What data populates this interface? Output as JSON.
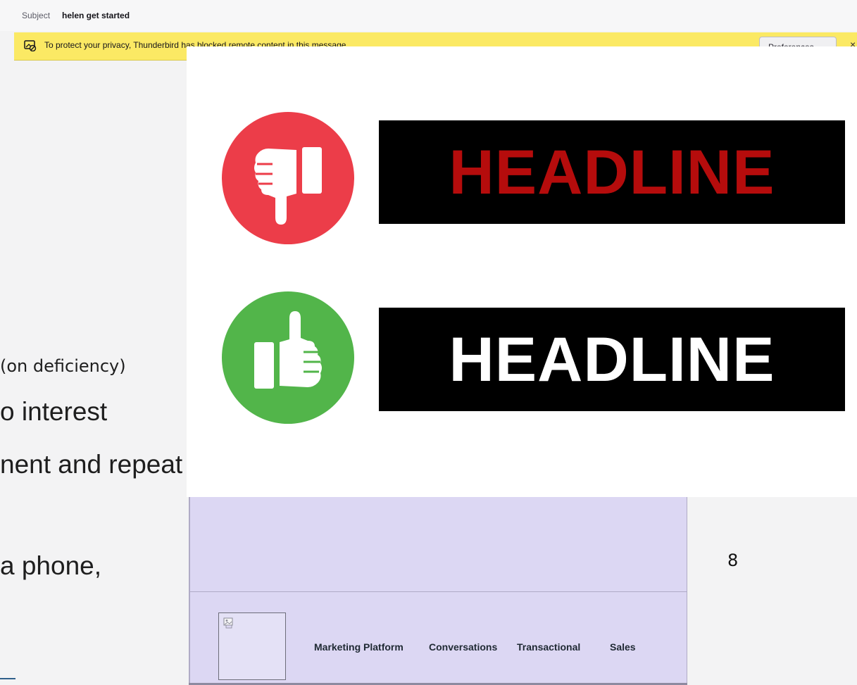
{
  "message_header": {
    "subject_label": "Subject",
    "subject_value": "helen get started"
  },
  "privacy_notice": {
    "text": "To protect your privacy, Thunderbird has blocked remote content in this message.",
    "preferences_label": "Preferences",
    "close_label": "×",
    "icon": "blocked-content-icon"
  },
  "slide": {
    "line1": "(on deficiency)",
    "line2": "o interest",
    "line3": "nent and repeat",
    "line4": "a phone,",
    "page_number": "8"
  },
  "headline_graphic": {
    "bad_headline": "HEADLINE",
    "good_headline": "HEADLINE",
    "bad_icon": "thumbs-down-icon",
    "good_icon": "thumbs-up-icon",
    "colors": {
      "bad_circle": "#ec3d49",
      "good_circle": "#52b54a",
      "bad_text": "#b50c0c",
      "good_text": "#ffffff",
      "box": "#000000"
    }
  },
  "email_nav": {
    "links": [
      "Marketing Platform",
      "Conversations",
      "Transactional",
      "Sales"
    ],
    "background": "#dcd7f3"
  }
}
